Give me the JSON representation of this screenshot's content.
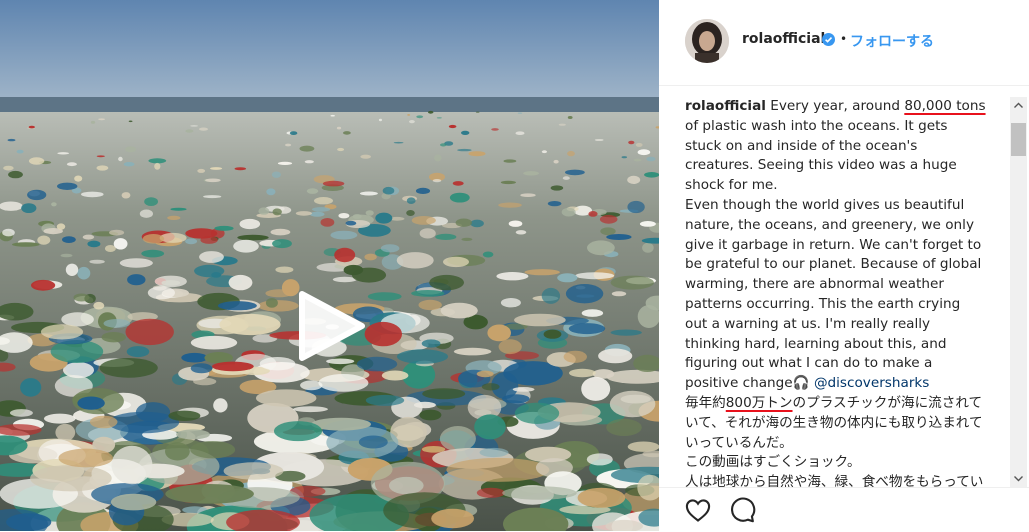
{
  "post": {
    "username": "rolaofficial",
    "follow_label": "フォローする",
    "separator": "•"
  },
  "caption": {
    "username": "rolaofficial",
    "t1": " Every year, around ",
    "highlight1": "80,000 tons",
    "t2": " of plastic wash into the oceans. It gets stuck on and inside of the ocean's creatures. Seeing this video was a huge shock for me.",
    "p2": "Even though the world gives us beautiful nature, the oceans, and greenery, we only give it garbage in return. We can't forget to be grateful to our planet. Because of global warming, there are abnormal weather patterns occurring. This the earth crying out a warning at us. I'm really really thinking hard, learning about this, and figuring out what I can do to make a positive change",
    "emoji": "🎧",
    "mention": "@discoversharks",
    "jp_pre": "毎年約",
    "jp_highlight": "800万トン",
    "jp_post": "のプラスチックが海に流されていて、それが海の生き物の体内にも取り込まれていっているんだ。",
    "jp2": "この動画はすごくショック。",
    "jp3": "人は地球から自然や海、緑、食べ物をもらっているのに"
  },
  "icons": {
    "play": "play-icon",
    "verified": "verified-badge-icon",
    "like": "heart-icon",
    "comment": "comment-bubble-icon",
    "scroll_up": "scroll-up-arrow-icon",
    "scroll_down": "scroll-down-arrow-icon"
  },
  "colors": {
    "link_blue": "#3897f0",
    "highlight_underline": "#e8111c",
    "text": "#262626"
  }
}
